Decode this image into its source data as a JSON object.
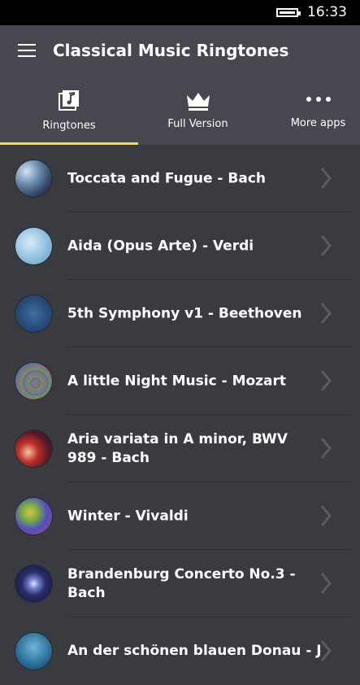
{
  "status": {
    "time": "16:33"
  },
  "app": {
    "title": "Classical Music Ringtones"
  },
  "tabs": [
    {
      "label": "Ringtones",
      "icon": "music-note-icon",
      "active": true
    },
    {
      "label": "Full Version",
      "icon": "crown-icon",
      "active": false
    },
    {
      "label": "More apps",
      "icon": "more-dots-icon",
      "active": false
    }
  ],
  "colors": {
    "header": "#46474f",
    "list_bg": "#3a3b41",
    "accent": "#f2df3b"
  },
  "items": [
    {
      "label": "Toccata and Fugue - Bach"
    },
    {
      "label": "Aida (Opus Arte) - Verdi"
    },
    {
      "label": "5th Symphony v1 - Beethoven"
    },
    {
      "label": "A little Night Music - Mozart"
    },
    {
      "label": "Aria variata in A minor, BWV 989 - Bach"
    },
    {
      "label": "Winter - Vivaldi"
    },
    {
      "label": "Brandenburg Concerto No.3 - Bach"
    },
    {
      "label": "An der schönen blauen Donau - J"
    }
  ]
}
